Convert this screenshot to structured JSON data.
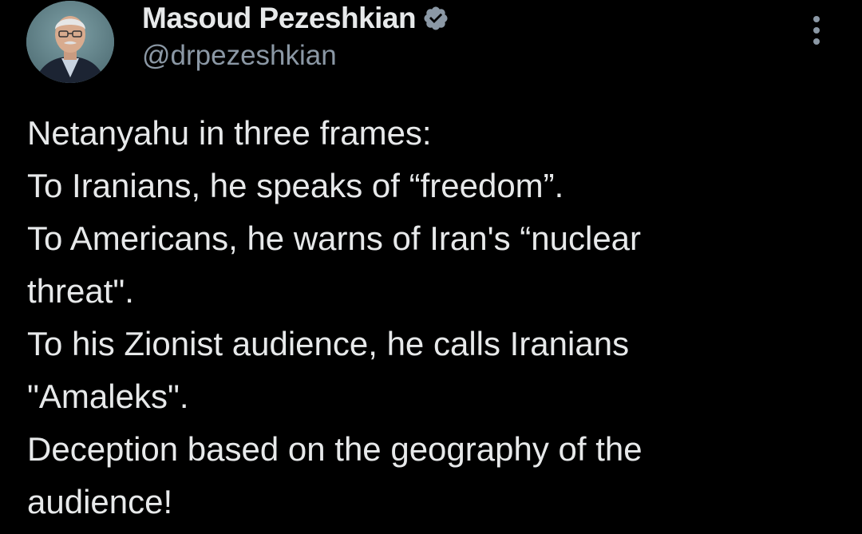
{
  "author": {
    "name": "Masoud Pezeshkian",
    "handle": "@drpezeshkian",
    "verified_icon": "verified-badge-icon",
    "verified_color": "#8b98a5"
  },
  "menu": {
    "icon": "more-vertical-icon"
  },
  "tweet": {
    "lines": [
      "Netanyahu in three frames:",
      "To Iranians, he speaks of “freedom”.",
      "To Americans, he warns of Iran's “nuclear",
      "threat\".",
      "To his Zionist audience, he calls Iranians",
      "\"Amaleks\".",
      "Deception based on the geography of the",
      "audience!"
    ]
  },
  "colors": {
    "background": "#000000",
    "text_primary": "#e7e9ea",
    "text_secondary": "#8b98a5"
  }
}
